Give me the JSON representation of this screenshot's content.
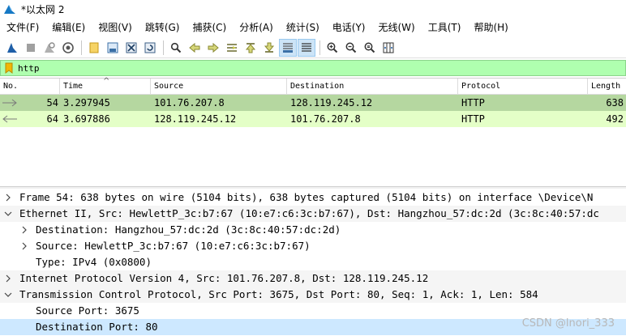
{
  "window": {
    "title": "*以太网 2",
    "icon": "wireshark-fin-icon"
  },
  "menu": [
    "文件(F)",
    "编辑(E)",
    "视图(V)",
    "跳转(G)",
    "捕获(C)",
    "分析(A)",
    "统计(S)",
    "电话(Y)",
    "无线(W)",
    "工具(T)",
    "帮助(H)"
  ],
  "toolbar": {
    "icons": [
      "start-capture-icon",
      "stop-capture-icon",
      "restart-capture-icon",
      "capture-options-icon",
      "open-file-icon",
      "save-file-icon",
      "close-file-icon",
      "reload-file-icon",
      "find-packet-icon",
      "go-back-icon",
      "go-forward-icon",
      "go-to-packet-icon",
      "go-first-icon",
      "go-last-icon",
      "autoscroll-icon",
      "colorize-icon",
      "zoom-in-icon",
      "zoom-out-icon",
      "normal-size-icon",
      "resize-columns-icon"
    ],
    "active": [
      "autoscroll-icon",
      "colorize-icon"
    ]
  },
  "filter": {
    "value": "http",
    "color": "#afffaf"
  },
  "packet_list": {
    "columns": [
      "No.",
      "Time",
      "Source",
      "Destination",
      "Protocol",
      "Length"
    ],
    "rows": [
      {
        "no": "54",
        "time": "3.297945",
        "source": "101.76.207.8",
        "destination": "128.119.245.12",
        "protocol": "HTTP",
        "length": "638",
        "direction": "request",
        "selected": true
      },
      {
        "no": "64",
        "time": "3.697886",
        "source": "128.119.245.12",
        "destination": "101.76.207.8",
        "protocol": "HTTP",
        "length": "492",
        "direction": "response",
        "selected": false
      }
    ],
    "selected_color": "#b5d7a0",
    "http_color": "#e4ffc7"
  },
  "details": {
    "rows": [
      {
        "text": "Frame 54: 638 bytes on wire (5104 bits), 638 bytes captured (5104 bits) on interface \\Device\\N",
        "state": "collapsed",
        "indent": 0
      },
      {
        "text": "Ethernet II, Src: HewlettP_3c:b7:67 (10:e7:c6:3c:b7:67), Dst: Hangzhou_57:dc:2d (3c:8c:40:57:dc",
        "state": "expanded",
        "indent": 0
      },
      {
        "text": "Destination: Hangzhou_57:dc:2d (3c:8c:40:57:dc:2d)",
        "state": "collapsed",
        "indent": 1
      },
      {
        "text": "Source: HewlettP_3c:b7:67 (10:e7:c6:3c:b7:67)",
        "state": "collapsed",
        "indent": 1
      },
      {
        "text": "Type: IPv4 (0x0800)",
        "state": "leaf",
        "indent": 1
      },
      {
        "text": "Internet Protocol Version 4, Src: 101.76.207.8, Dst: 128.119.245.12",
        "state": "collapsed",
        "indent": 0
      },
      {
        "text": "Transmission Control Protocol, Src Port: 3675, Dst Port: 80, Seq: 1, Ack: 1, Len: 584",
        "state": "expanded",
        "indent": 0
      },
      {
        "text": "Source Port: 3675",
        "state": "leaf",
        "indent": 1
      },
      {
        "text": "Destination Port: 80",
        "state": "leaf",
        "indent": 1,
        "selected": true
      }
    ]
  },
  "watermark": "CSDN @lnori_333"
}
